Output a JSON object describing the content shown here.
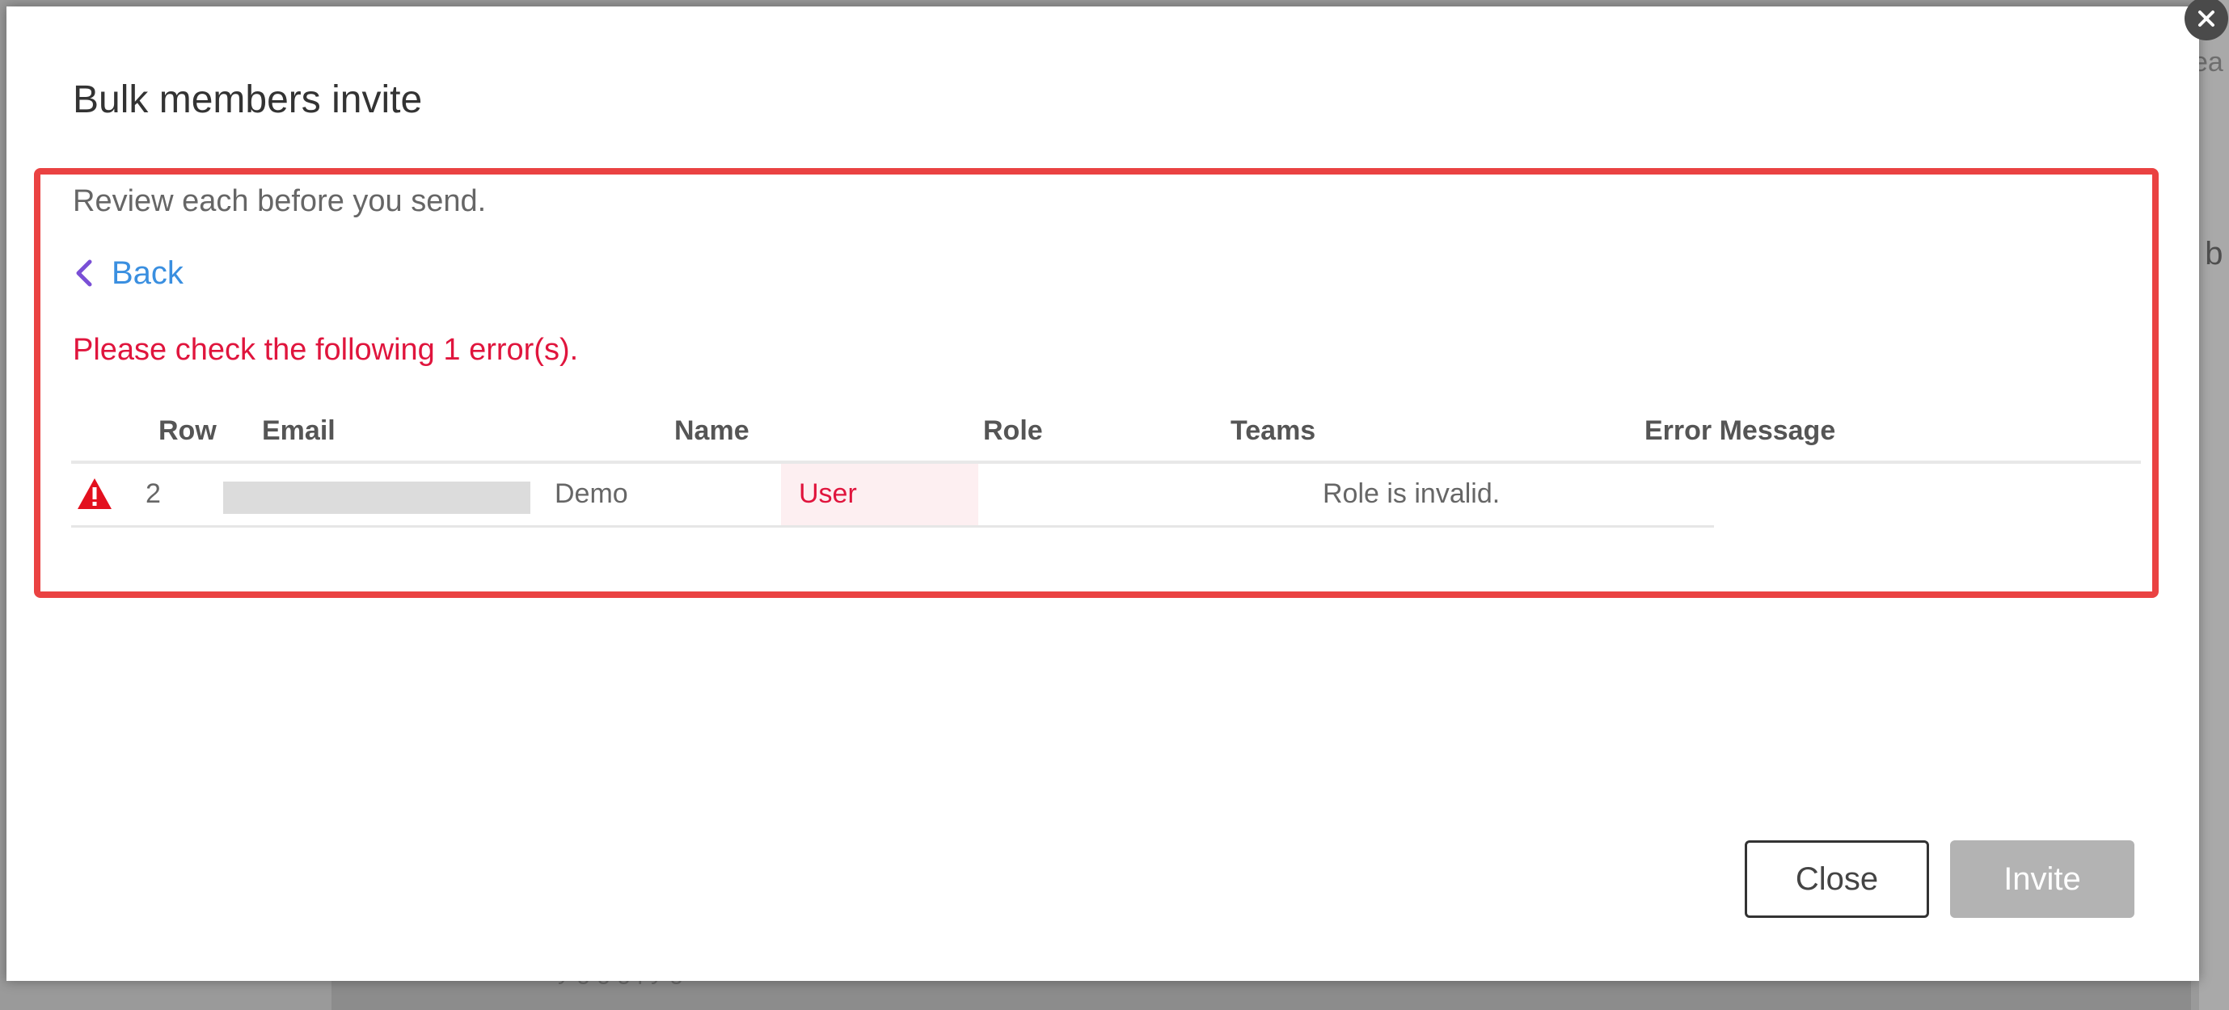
{
  "background": {
    "right_text_1": "ea",
    "right_text_2": "t b",
    "bottom_text": "y     g   g    g   py     g"
  },
  "modal": {
    "title": "Bulk members invite",
    "subtitle": "Review each before you send.",
    "back_label": "Back",
    "error_summary": "Please check the following 1 error(s).",
    "table": {
      "headers": {
        "row": "Row",
        "email": "Email",
        "name": "Name",
        "role": "Role",
        "teams": "Teams",
        "error_message": "Error Message"
      },
      "rows": [
        {
          "row": "2",
          "email": "",
          "name": "Demo",
          "role": "User",
          "teams": "",
          "error_message": "Role is invalid.",
          "status_icon": "warning-triangle-icon"
        }
      ]
    },
    "buttons": {
      "close_label": "Close",
      "invite_label": "Invite"
    }
  },
  "colors": {
    "highlight_border": "#ea4242",
    "error_text": "#e0153d",
    "link": "#3a8fe0",
    "back_chevron": "#7a4fd6",
    "invite_disabled": "#b3b3b3",
    "role_cell_bg": "#fdeff1"
  }
}
